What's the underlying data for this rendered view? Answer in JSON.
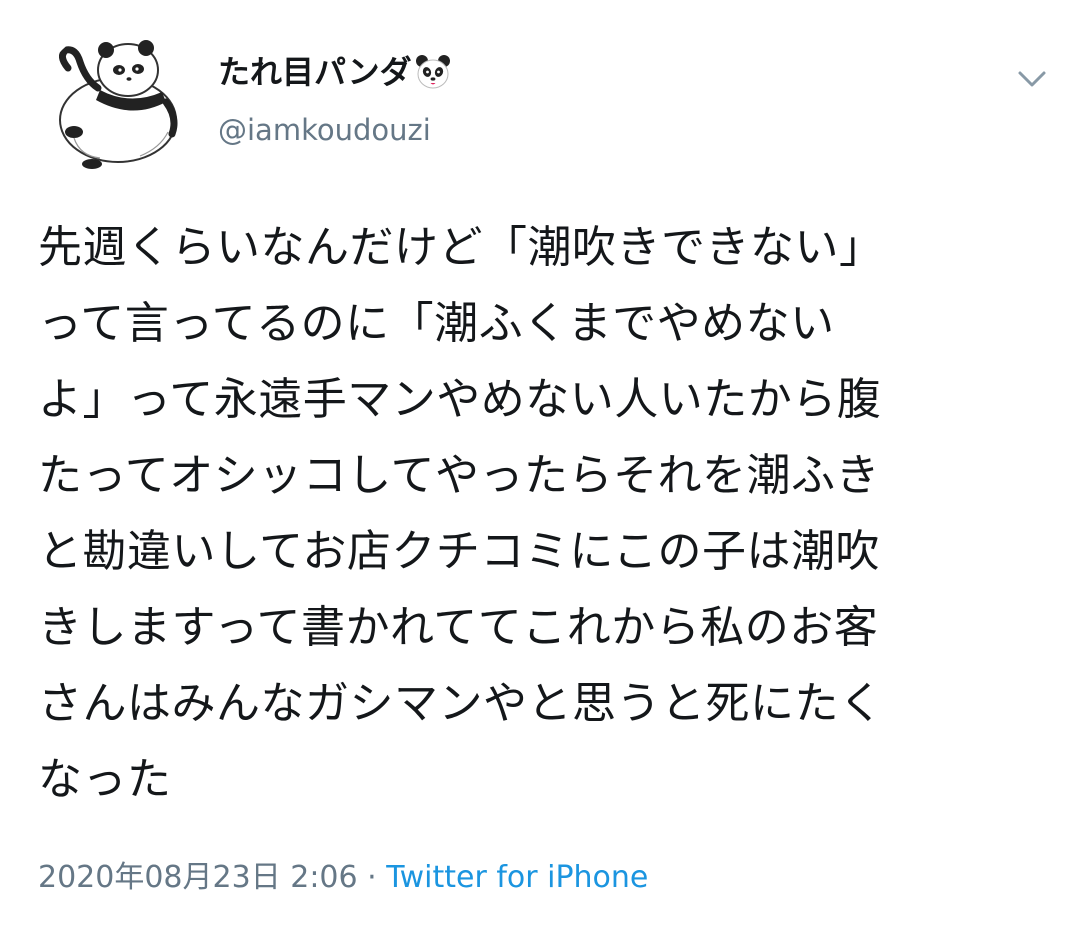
{
  "tweet": {
    "display_name": "たれ目パンダ",
    "name_emoji": "panda-face-icon",
    "handle": "@iamkoudouzi",
    "text_lines": [
      "先週くらいなんだけど「潮吹きできない」",
      "って言ってるのに「潮ふくまでやめない",
      "よ」って永遠手マンやめない人いたから腹",
      "たってオシッコしてやったらそれを潮ふき",
      "と勘違いしてお店クチコミにこの子は潮吹",
      "きしますって書かれててこれから私のお客",
      "さんはみんなガシマンやと思うと死にたく",
      "なった"
    ],
    "timestamp": "2020年08月23日 2:06",
    "separator": "·",
    "source": "Twitter for iPhone"
  },
  "colors": {
    "text": "#14171a",
    "secondary": "#657786",
    "link": "#1b95e0",
    "chevron": "#8899a6"
  },
  "icons": {
    "avatar": "panda-illustration-avatar",
    "menu": "chevron-down-icon"
  }
}
